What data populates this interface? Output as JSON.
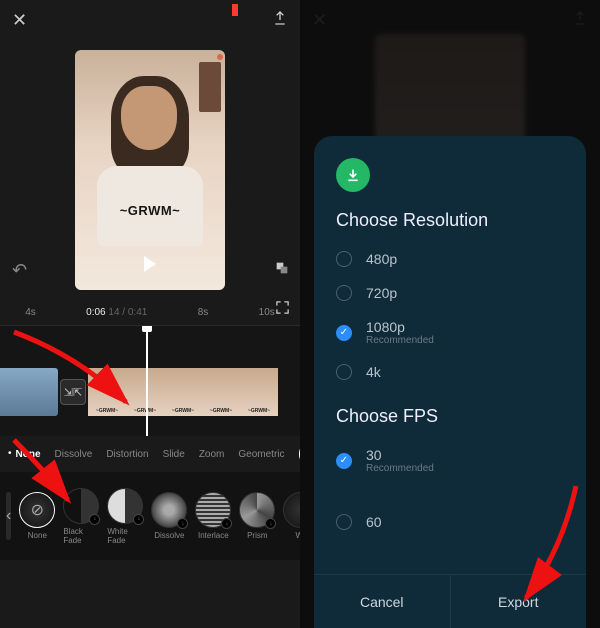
{
  "left": {
    "preview_caption": "~GRWM~",
    "ruler": {
      "t_4s": "4s",
      "current": "0:06",
      "frame": "14 / 0:41",
      "t_8s": "8s",
      "t_10s": "10s"
    },
    "thumb_label": "~GRWM~",
    "transition_tabs": {
      "none": "None",
      "dissolve": "Dissolve",
      "distortion": "Distortion",
      "slide": "Slide",
      "zoom": "Zoom",
      "geometric": "Geometric"
    },
    "effects": {
      "none": "None",
      "black_fade": "Black Fade",
      "white_fade": "White Fade",
      "dissolve": "Dissolve",
      "interlace": "Interlace",
      "prism": "Prism",
      "wave": "Wa"
    }
  },
  "right": {
    "title_res": "Choose Resolution",
    "res": {
      "r480": "480p",
      "r720": "720p",
      "r1080": "1080p",
      "rec": "Recommended",
      "r4k": "4k"
    },
    "title_fps": "Choose FPS",
    "fps": {
      "f30": "30",
      "rec": "Recommended",
      "f60": "60"
    },
    "cancel": "Cancel",
    "export": "Export"
  }
}
